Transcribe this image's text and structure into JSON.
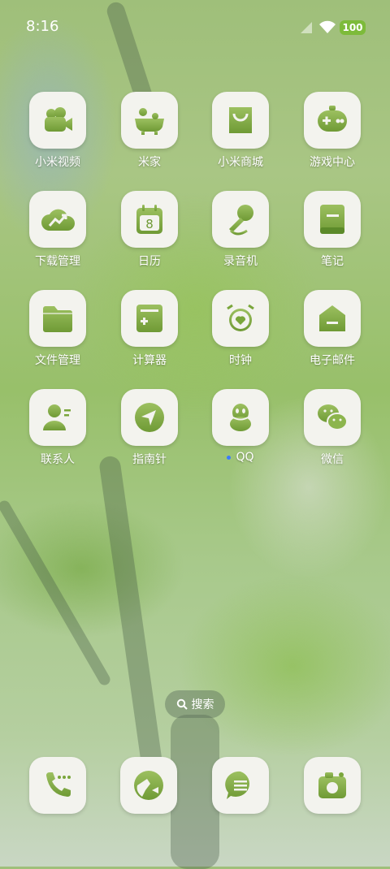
{
  "status_bar": {
    "time": "8:16",
    "battery": "100"
  },
  "colors": {
    "icon_green": "#7aa63b",
    "tile_bg": "#f3f3ee",
    "battery": "#7dbb3a"
  },
  "apps": [
    {
      "label": "小米视频",
      "icon": "video-camera-icon"
    },
    {
      "label": "米家",
      "icon": "mi-home-icon"
    },
    {
      "label": "小米商城",
      "icon": "shopping-bag-icon"
    },
    {
      "label": "游戏中心",
      "icon": "gamepad-icon"
    },
    {
      "label": "下载管理",
      "icon": "cloud-download-icon"
    },
    {
      "label": "日历",
      "icon": "calendar-icon",
      "calendar_day": "8"
    },
    {
      "label": "录音机",
      "icon": "microphone-icon"
    },
    {
      "label": "笔记",
      "icon": "notebook-icon"
    },
    {
      "label": "文件管理",
      "icon": "folder-icon"
    },
    {
      "label": "计算器",
      "icon": "calculator-icon"
    },
    {
      "label": "时钟",
      "icon": "alarm-clock-icon"
    },
    {
      "label": "电子邮件",
      "icon": "mail-icon"
    },
    {
      "label": "联系人",
      "icon": "contact-icon"
    },
    {
      "label": "指南针",
      "icon": "compass-icon"
    },
    {
      "label": "QQ",
      "icon": "qq-penguin-icon"
    },
    {
      "label": "微信",
      "icon": "wechat-icon"
    }
  ],
  "search": {
    "label": "搜索"
  },
  "dock": [
    {
      "icon": "phone-icon"
    },
    {
      "icon": "browser-globe-icon"
    },
    {
      "icon": "messages-icon"
    },
    {
      "icon": "camera-icon"
    }
  ]
}
